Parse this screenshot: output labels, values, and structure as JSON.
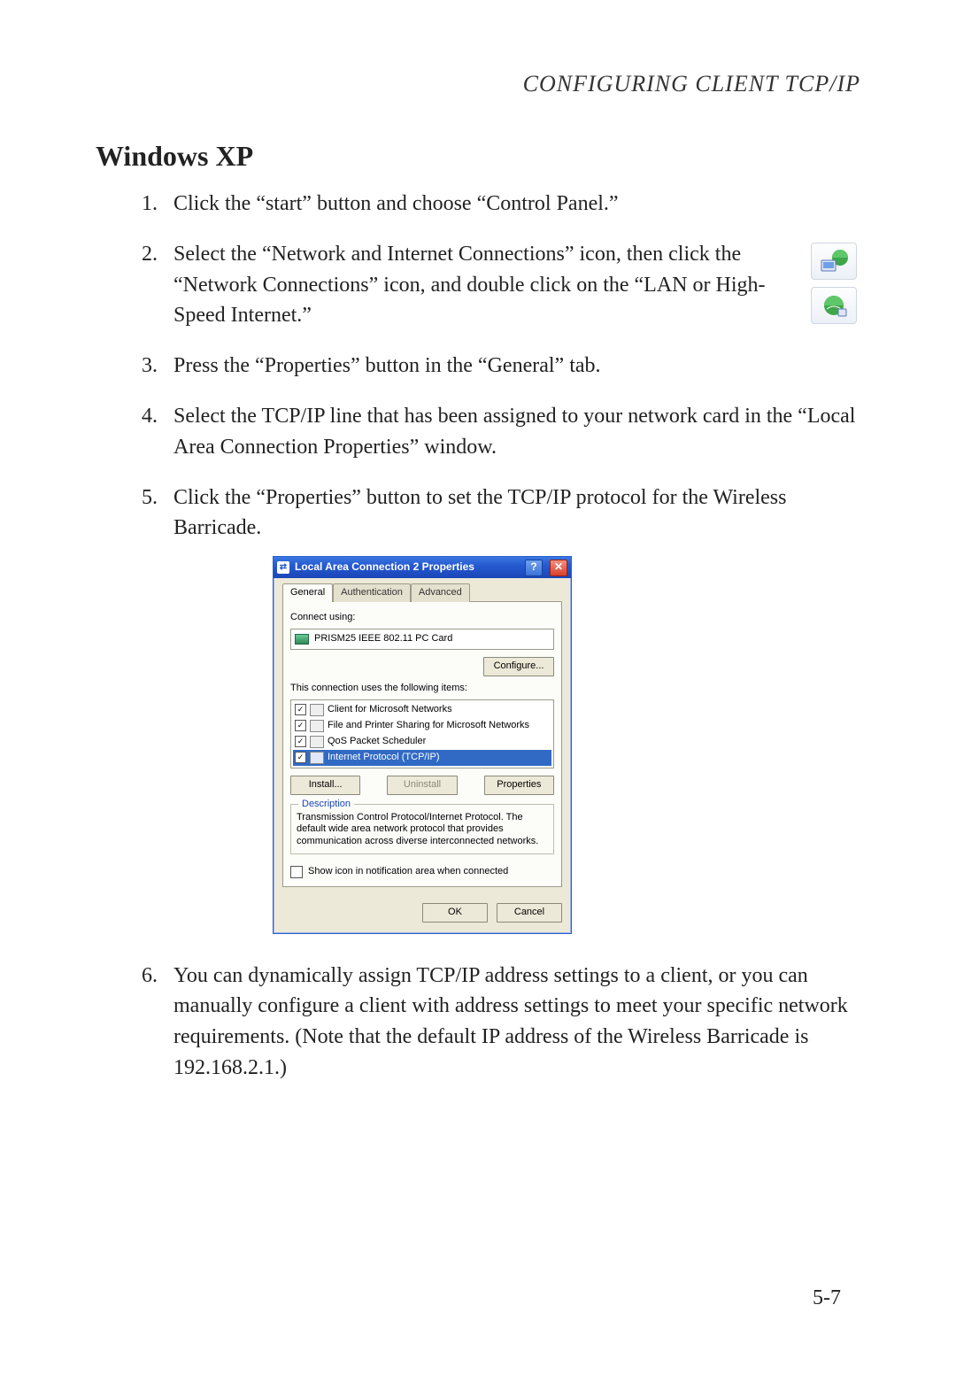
{
  "header": {
    "running": "CONFIGURING CLIENT TCP/IP"
  },
  "section": {
    "title": "Windows XP"
  },
  "steps": {
    "s1": "Click the “start” button and choose “Control Panel.”",
    "s2": "Select the “Network and Internet Connections” icon, then click the “Network Connections” icon, and double click on the “LAN or High-Speed Internet.”",
    "s3": "Press the “Properties” button in the “General” tab.",
    "s4": "Select the TCP/IP line that has been assigned to your network card in the “Local Area Connection Properties” window.",
    "s5": "Click the “Properties” button to set the TCP/IP protocol for the Wireless Barricade.",
    "s6": "You can dynamically assign TCP/IP address settings to a client, or you can manually configure a client with address settings to meet your specific network requirements. (Note that the default IP address of the Wireless Barricade is 192.168.2.1.)"
  },
  "nums": {
    "n1": "1.",
    "n2": "2.",
    "n3": "3.",
    "n4": "4.",
    "n5": "5.",
    "n6": "6."
  },
  "dialog": {
    "title": "Local Area Connection 2 Properties",
    "help_glyph": "?",
    "close_glyph": "✕",
    "tabs": {
      "general": "General",
      "auth": "Authentication",
      "adv": "Advanced"
    },
    "connect_label": "Connect using:",
    "adapter": "PRISM25 IEEE 802.11 PC Card",
    "configure": "Configure...",
    "items_label": "This connection uses the following items:",
    "items": {
      "i1": "Client for Microsoft Networks",
      "i2": "File and Printer Sharing for Microsoft Networks",
      "i3": "QoS Packet Scheduler",
      "i4": "Internet Protocol (TCP/IP)"
    },
    "check": "✓",
    "install": "Install...",
    "uninstall": "Uninstall",
    "properties": "Properties",
    "desc_title": "Description",
    "desc_text": "Transmission Control Protocol/Internet Protocol. The default wide area network protocol that provides communication across diverse interconnected networks.",
    "show_icon": "Show icon in notification area when connected",
    "ok": "OK",
    "cancel": "Cancel"
  },
  "footer": {
    "page": "5-7"
  }
}
